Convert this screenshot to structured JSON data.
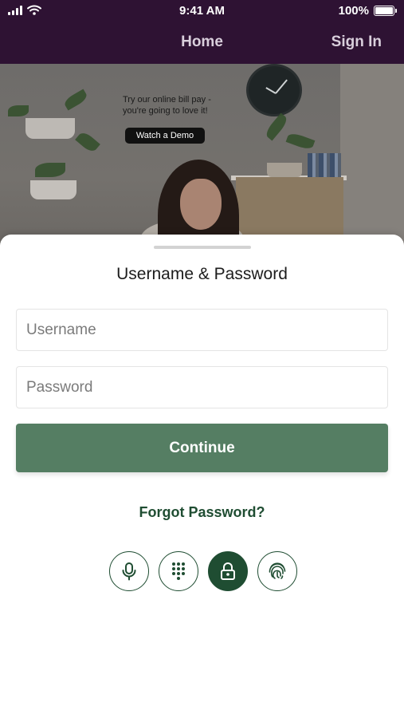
{
  "status_bar": {
    "time": "9:41 AM",
    "battery": "100%"
  },
  "nav": {
    "title": "Home",
    "sign_in": "Sign In"
  },
  "hero": {
    "promo_text": "Try our online bill pay - you're going to love it!",
    "demo_button": "Watch a Demo"
  },
  "sheet": {
    "title": "Username & Password",
    "username_placeholder": "Username",
    "password_placeholder": "Password",
    "continue_label": "Continue",
    "forgot_label": "Forgot Password?"
  },
  "auth_methods": [
    {
      "icon": "microphone-icon",
      "active": false
    },
    {
      "icon": "keypad-icon",
      "active": false
    },
    {
      "icon": "lock-icon",
      "active": true
    },
    {
      "icon": "fingerprint-icon",
      "active": false
    }
  ],
  "colors": {
    "header_bg": "#2e1233",
    "primary_button": "#557e63",
    "accent_green": "#1f4d32"
  }
}
